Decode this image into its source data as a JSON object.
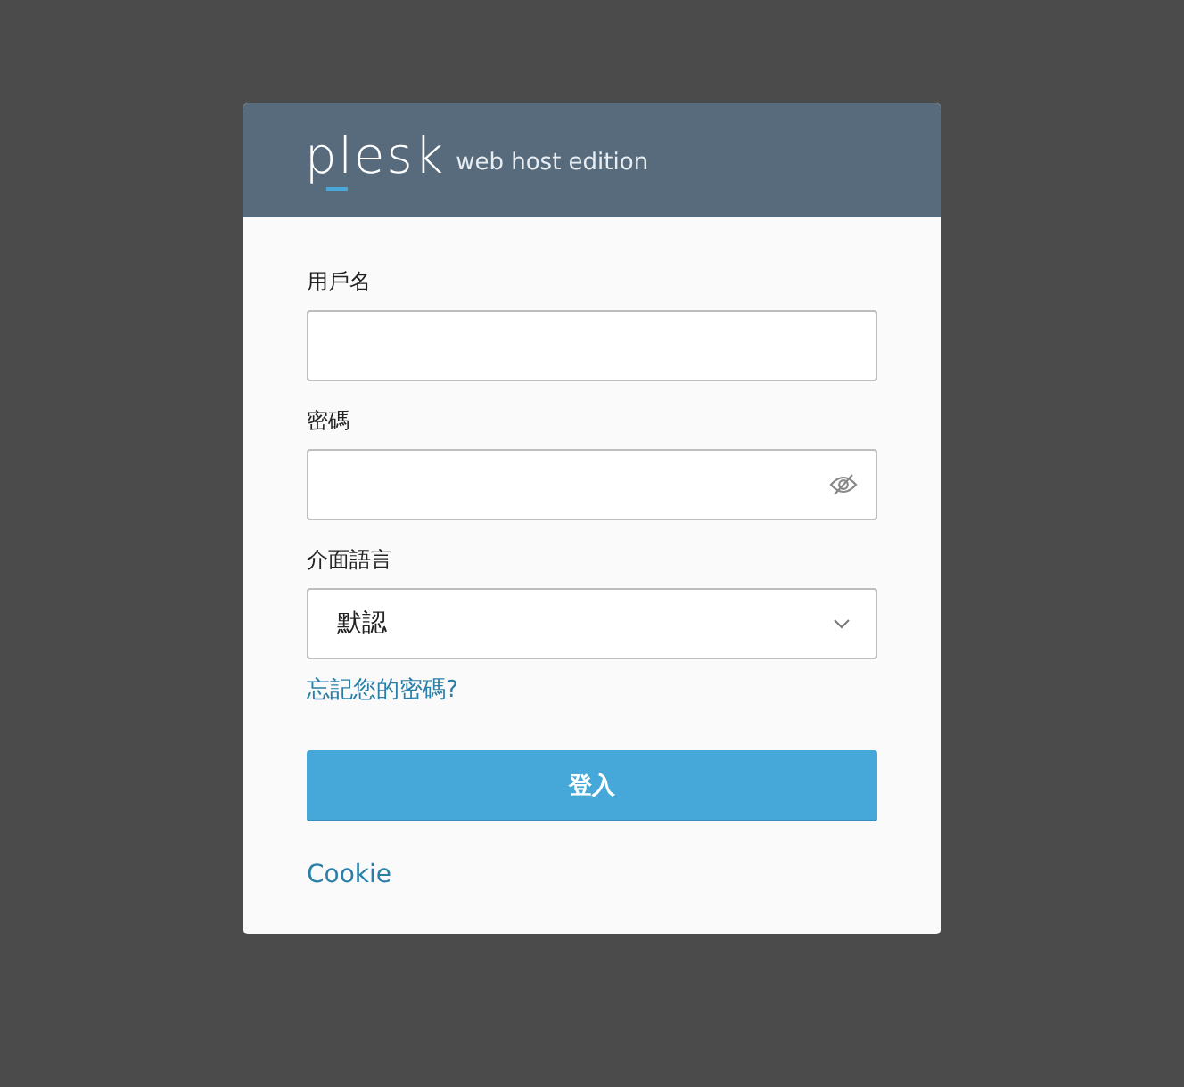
{
  "header": {
    "logo": "plesk",
    "edition": "web host edition"
  },
  "fields": [
    {
      "kind": "text",
      "label": "用戶名"
    },
    {
      "kind": "password",
      "label": "密碼"
    },
    {
      "kind": "select",
      "label": "介面語言",
      "value": "默認"
    }
  ],
  "forgot_link": "忘記您的密碼?",
  "login_button": "登入",
  "cookie_link": "Cookie"
}
